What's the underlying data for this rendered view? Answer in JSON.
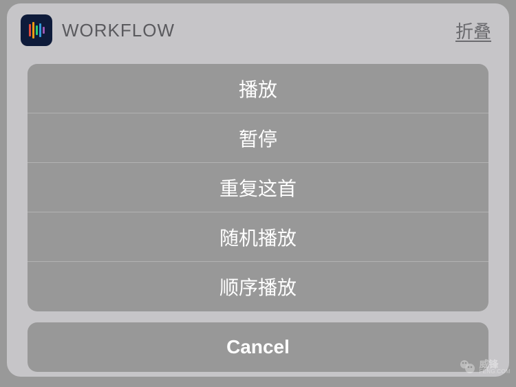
{
  "header": {
    "app_title": "WORKFLOW",
    "collapse_label": "折叠"
  },
  "options": {
    "items": [
      {
        "label": "播放"
      },
      {
        "label": "暂停"
      },
      {
        "label": "重复这首"
      },
      {
        "label": "随机播放"
      },
      {
        "label": "顺序播放"
      }
    ]
  },
  "cancel": {
    "label": "Cancel"
  },
  "watermark": {
    "brand": "威锋",
    "domain": "FENG.COM"
  }
}
